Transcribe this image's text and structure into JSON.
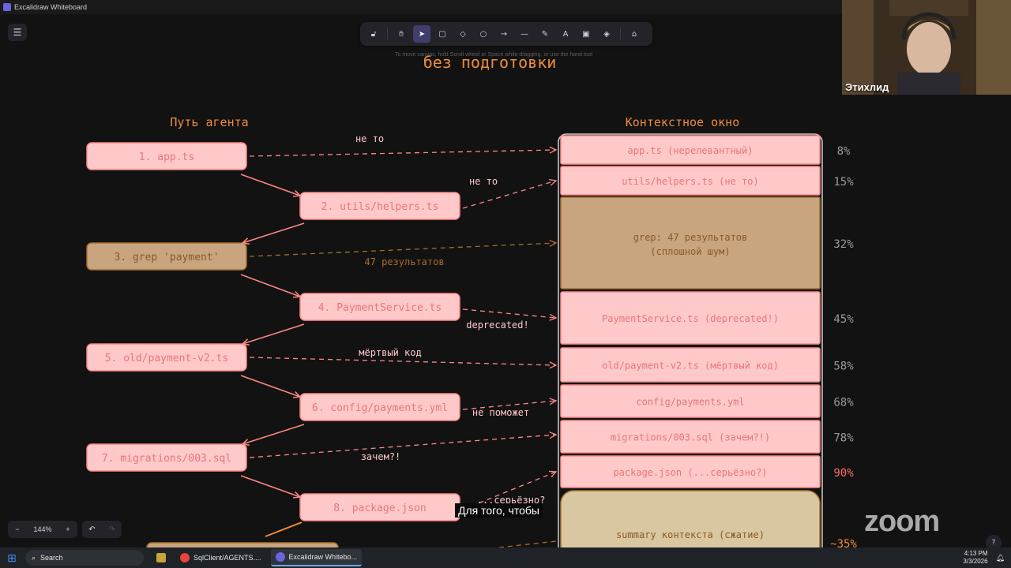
{
  "window": {
    "title": "Excalidraw Whiteboard"
  },
  "toolbar": {
    "tools": [
      {
        "name": "lock-tool",
        "glyph": "🔓︎"
      },
      {
        "name": "hand-tool",
        "glyph": "✋︎"
      },
      {
        "name": "selection-tool",
        "glyph": "➤"
      },
      {
        "name": "rectangle-tool",
        "glyph": "▢"
      },
      {
        "name": "diamond-tool",
        "glyph": "◇"
      },
      {
        "name": "ellipse-tool",
        "glyph": "○"
      },
      {
        "name": "arrow-tool",
        "glyph": "→"
      },
      {
        "name": "line-tool",
        "glyph": "—"
      },
      {
        "name": "draw-tool",
        "glyph": "✎"
      },
      {
        "name": "text-tool",
        "glyph": "A"
      },
      {
        "name": "image-tool",
        "glyph": "▣"
      },
      {
        "name": "eraser-tool",
        "glyph": "◈"
      },
      {
        "name": "extra-tools",
        "glyph": "⌂"
      }
    ],
    "active": "selection-tool",
    "hint": "To move canvas, hold Scroll wheel or Space while dragging, or use the hand tool"
  },
  "heading_partial": "без подготовки",
  "left_column_title": "Путь агента",
  "right_column_title": "Контекстное окно",
  "agent_steps": [
    {
      "label": "1. app.ts",
      "kind": "pink"
    },
    {
      "label": "2. utils/helpers.ts",
      "kind": "pink"
    },
    {
      "label": "3. grep 'payment'",
      "kind": "tan"
    },
    {
      "label": "4. PaymentService.ts",
      "kind": "pink"
    },
    {
      "label": "5. old/payment-v2.ts",
      "kind": "pink"
    },
    {
      "label": "6. config/payments.yml",
      "kind": "pink"
    },
    {
      "label": "7. migrations/003.sql",
      "kind": "pink"
    },
    {
      "label": "8. package.json",
      "kind": "pink"
    }
  ],
  "arrow_labels": [
    "не то",
    "не то",
    "47 результатов",
    "deprecated!",
    "мёртвый код",
    "не поможет",
    "зачем?!",
    "...серьёзно?"
  ],
  "context_rows": [
    {
      "label": "app.ts (нерелевантный)",
      "pct": "8%",
      "kind": "pink"
    },
    {
      "label": "utils/helpers.ts (не то)",
      "pct": "15%",
      "kind": "pink"
    },
    {
      "label": "grep: 47 результатов",
      "label2": "(сплошной шум)",
      "pct": "32%",
      "kind": "tan"
    },
    {
      "label": "PaymentService.ts (deprecated!)",
      "pct": "45%",
      "kind": "pink"
    },
    {
      "label": "old/payment-v2.ts (мёртвый код)",
      "pct": "58%",
      "kind": "pink"
    },
    {
      "label": "config/payments.yml",
      "pct": "68%",
      "kind": "pink"
    },
    {
      "label": "migrations/003.sql (зачем?!)",
      "pct": "78%",
      "kind": "pink"
    },
    {
      "label": "package.json (...серьёзно?)",
      "pct": "90%",
      "kind": "pink",
      "pct_highlight": true
    },
    {
      "label": "summary контекста (сжатие)",
      "pct": "~35%",
      "kind": "summary"
    }
  ],
  "colors": {
    "pink_fill": "#ffc9c9",
    "pink_stroke": "#ff8787",
    "pink_text": "#e8767a",
    "tan_fill": "#c8a47f",
    "tan_stroke": "#a66e2a",
    "tan_text": "#8a5a25",
    "summary_fill": "#d9c7a2",
    "title_orange": "#f08c3c",
    "pct_gray": "#9a9a9a",
    "pct_red": "#ff6b6b"
  },
  "zoom": {
    "level": "144%",
    "minus": "−",
    "plus": "+"
  },
  "undo_glyph": "↶",
  "redo_glyph": "↷",
  "menu_glyph": "☰",
  "webcam": {
    "name": "Этихлид"
  },
  "subtitle": "Для того, чтобы",
  "zoom_watermark": "zoom",
  "help_glyph": "?",
  "taskbar": {
    "search": "Search",
    "apps": [
      {
        "label": "SqlClient/AGENTS....",
        "color": "#e8453c",
        "active": false
      },
      {
        "label": "Excalidraw Whitebo...",
        "color": "#6965db",
        "active": true
      }
    ],
    "time": "4:13 PM",
    "date": "3/3/2026"
  }
}
